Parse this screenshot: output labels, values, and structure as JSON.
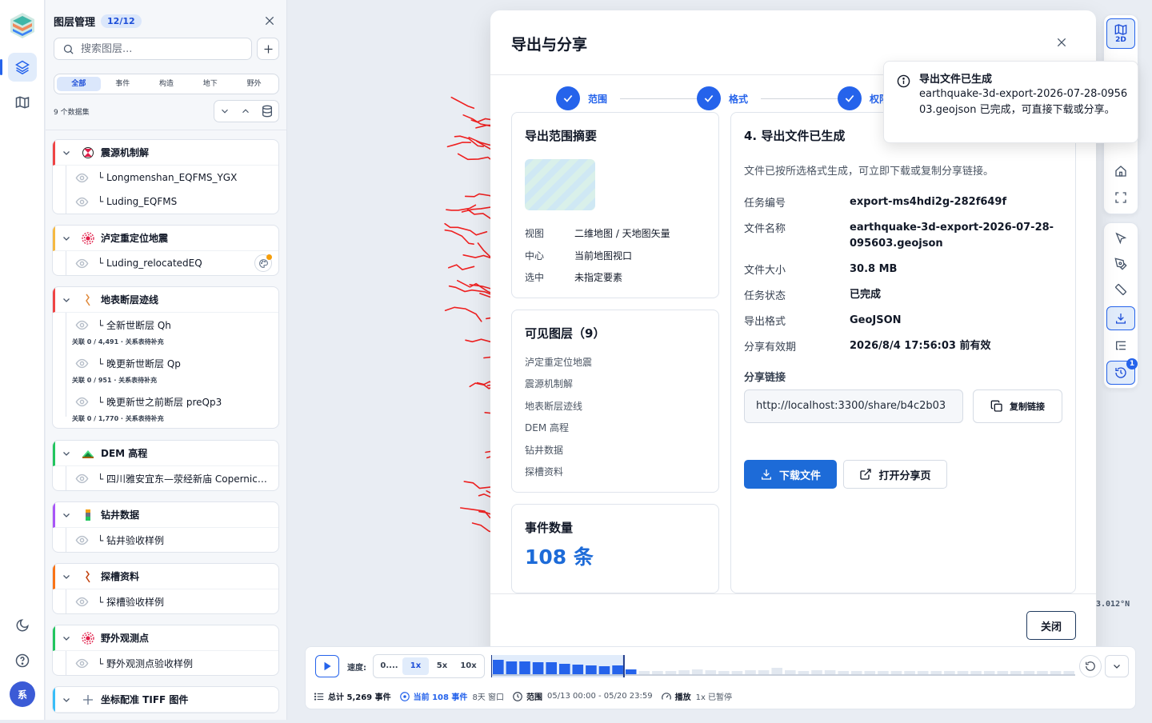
{
  "rail": {
    "avatar": "系"
  },
  "layer_panel": {
    "title": "图层管理",
    "count_badge": "12/12",
    "search_placeholder": "搜索图层...",
    "tabs": [
      "全部",
      "事件",
      "构造",
      "地下",
      "野外"
    ],
    "active_tab": "全部",
    "dataset_count": "9 个数据集",
    "groups": [
      {
        "name": "震源机制解",
        "color": "#ef4444",
        "icon": "focal-mechanism-icon",
        "layers": [
          {
            "name": "└ Longmenshan_EQFMS_YGX"
          },
          {
            "name": "└ Luding_EQFMS"
          }
        ]
      },
      {
        "name": "泸定重定位地震",
        "color": "#f5b942",
        "icon": "earthquake-ring-icon",
        "layers": [
          {
            "name": "└ Luding_relocatedEQ"
          }
        ]
      },
      {
        "name": "地表断层迹线",
        "color": "#ef4444",
        "icon": "fault-line-icon",
        "layers": [
          {
            "name": "└ 全新世断层 Qh",
            "meta": "关联 0 / 4,491 · 关系表待补充"
          },
          {
            "name": "└ 晚更新世断层 Qp",
            "meta": "关联 0 / 951 · 关系表待补充"
          },
          {
            "name": "└ 晚更新世之前断层 preQp3",
            "meta": "关联 0 / 1,770 · 关系表待补充"
          }
        ]
      },
      {
        "name": "DEM 高程",
        "color": "#22c55e",
        "icon": "terrain-icon",
        "layers": [
          {
            "name": "└ 四川雅安宜东—荥经新庙 Copernicu..."
          }
        ]
      },
      {
        "name": "钻井数据",
        "color": "#a855f7",
        "icon": "borehole-icon",
        "layers": [
          {
            "name": "└ 钻井验收样例"
          }
        ]
      },
      {
        "name": "探槽资料",
        "color": "#f97316",
        "icon": "trench-icon",
        "layers": [
          {
            "name": "└ 探槽验收样例"
          }
        ]
      },
      {
        "name": "野外观测点",
        "color": "#22c55e",
        "icon": "field-point-icon",
        "layers": [
          {
            "name": "└ 野外观测点验收样例"
          }
        ]
      },
      {
        "name": "坐标配准 TIFF 图件",
        "color": "#38bdf8",
        "icon": "georef-icon",
        "layers": []
      }
    ]
  },
  "dialog": {
    "title": "导出与分享",
    "steps": [
      "范围",
      "格式",
      "权限"
    ],
    "summary": {
      "title": "导出范围摘要",
      "rows": [
        {
          "k": "视图",
          "v": "二维地图 / 天地图矢量"
        },
        {
          "k": "中心",
          "v": "当前地图视口"
        },
        {
          "k": "选中",
          "v": "未指定要素"
        }
      ]
    },
    "visible_layers": {
      "title": "可见图层（9）",
      "items": [
        "泸定重定位地震",
        "震源机制解",
        "地表断层迹线",
        "DEM 高程",
        "钻井数据",
        "探槽资料"
      ]
    },
    "events": {
      "title": "事件数量",
      "value": "108 条"
    },
    "result": {
      "title": "4. 导出文件已生成",
      "subtitle": "文件已按所选格式生成，可立即下载或复制分享链接。",
      "info": [
        {
          "k": "任务编号",
          "v": "export-ms4hdi2g-282f649f"
        },
        {
          "k": "文件名称",
          "v": "earthquake-3d-export-2026-07-28-095603.geojson"
        },
        {
          "k": "文件大小",
          "v": "30.8 MB"
        },
        {
          "k": "任务状态",
          "v": "已完成"
        },
        {
          "k": "导出格式",
          "v": "GeoJSON"
        },
        {
          "k": "分享有效期",
          "v": "2026/8/4 17:56:03 前有效"
        }
      ],
      "share_label": "分享链接",
      "share_url": "http://localhost:3300/share/b4c2b03",
      "copy_label": "复制链接",
      "download_label": "下载文件",
      "open_label": "打开分享页"
    },
    "close_label": "关闭"
  },
  "toast": {
    "title": "导出文件已生成",
    "body": "earthquake-3d-export-2026-07-28-095603.geojson 已完成，可直接下载或分享。"
  },
  "map": {
    "coord_readout": "3.012°N",
    "view_mode": "2D"
  },
  "timeline": {
    "speed_label": "速度:",
    "speeds": [
      "0....",
      "1x",
      "5x",
      "10x"
    ],
    "active_speed": "1x",
    "bars": [
      0.9,
      0.8,
      0.8,
      0.75,
      0.75,
      0.65,
      0.6,
      0.55,
      0.5,
      0.55,
      0.3,
      0.2,
      0.2,
      0.2,
      0.25,
      0.3,
      0.25,
      0.2,
      0.2,
      0.25,
      0.25,
      0.4,
      0.25,
      0.2,
      0.25,
      0.25,
      0.2,
      0.2,
      0.2,
      0.2,
      0.2,
      0.2,
      0.2,
      0.2,
      0.2,
      0.2,
      0.2,
      0.2,
      0.2,
      0.2,
      0.2,
      0.2,
      0.2,
      0.2
    ],
    "active_bars": 10,
    "total": "总计 5,269 事件",
    "current": "当前 108 事件",
    "window": "8天 窗口",
    "range_label": "范围",
    "range": "05/13 00:00 - 05/20 23:59",
    "playback_label": "播放",
    "playback": "1x 已暂停"
  }
}
